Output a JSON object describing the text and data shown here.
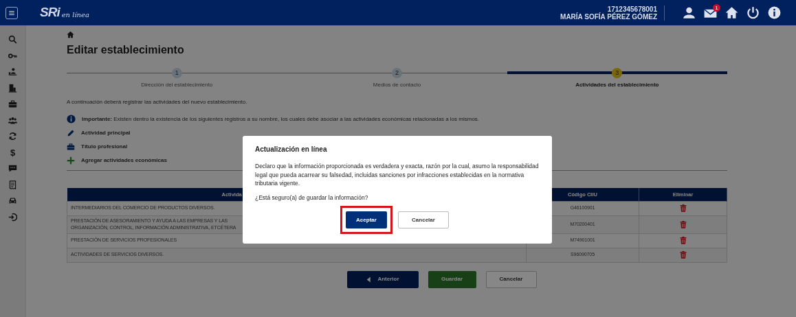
{
  "header": {
    "logo": "SRi",
    "logo_suffix": "en línea",
    "ruc": "1712345678001",
    "user": "MARÍA SOFÍA PÉREZ GÓMEZ",
    "mail_badge": "1"
  },
  "sidebar": {
    "items": [
      {
        "kind": "search"
      },
      {
        "kind": "key"
      },
      {
        "kind": "people"
      },
      {
        "kind": "building"
      },
      {
        "kind": "briefcase"
      },
      {
        "kind": "group"
      },
      {
        "kind": "refresh"
      },
      {
        "kind": "glyph",
        "text": "$"
      },
      {
        "kind": "chat"
      },
      {
        "kind": "document"
      },
      {
        "kind": "car"
      },
      {
        "kind": "signin"
      }
    ]
  },
  "page_title": "Editar establecimiento",
  "steps": [
    {
      "number": "1",
      "label": "Dirección del establecimiento",
      "selected": false
    },
    {
      "number": "2",
      "label": "Medios de contacto",
      "selected": false
    },
    {
      "number": "3",
      "label": "Actividades del establecimiento",
      "selected": true
    }
  ],
  "intro": "A continuación deberá registrar las actividades del nuevo establecimiento.",
  "notice": "**Importante:** Existen dentro la existencia de los siguientes registros a su nombre, los cuales debe asociar a las actividades económicas relacionadas a los mismos.",
  "links": [
    {
      "kind": "edit",
      "label": "Actividad principal"
    },
    {
      "kind": "briefcase",
      "label": "Título profesional"
    },
    {
      "kind": "add",
      "label": "Agregar actividades económicas"
    }
  ],
  "table": {
    "columns": [
      "Activida",
      "Código CIIU",
      "Eliminar"
    ],
    "rows": [
      {
        "activity": [
          "INTERMEDIARIOS DEL COMERCIO DE PRODUCTOS DIVERSOS."
        ],
        "code": "G46100901"
      },
      {
        "activity": [
          "PRESTACIÓN DE ASESORAMIENTO Y AYUDA A LAS EMPRESAS Y LAS",
          "ORGANIZACIÓN, CONTROL, INFORMACIÓN ADMINISTRATIVA, ETCÉTERA"
        ],
        "code": "M70200401"
      },
      {
        "activity": [
          "PRESTACIÓN DE SERVICIOS PROFESIONALES"
        ],
        "code": "M74901001"
      },
      {
        "activity": [
          "ACTIVIDADES DE SERVICIOS DIVERSOS."
        ],
        "code": "S96090705"
      }
    ]
  },
  "buttons": [
    {
      "kind": "back",
      "label": "Anterior"
    },
    {
      "kind": "save",
      "label": "Guardar"
    },
    {
      "kind": "outline",
      "label": "Cancelar"
    }
  ],
  "dialog": {
    "title": "Actualización en línea",
    "message": "Declaro que la información proporcionada es verdadera y exacta, razón por la cual, asumo la responsabilidad legal que pueda acarrear su falsedad, incluidas sanciones por infracciones establecidas en la normativa tributaria vigente.",
    "question": "¿Está seguro(a) de guardar la información?",
    "buttons": [
      {
        "kind": "primary",
        "label": "Aceptar",
        "highlighted": true
      },
      {
        "kind": "outline",
        "label": "Cancelar",
        "highlighted": false
      }
    ]
  }
}
